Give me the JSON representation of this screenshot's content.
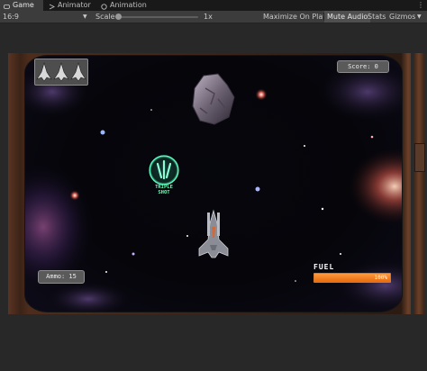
{
  "tabs": [
    {
      "label": "Game",
      "icon": "gamepad-icon",
      "active": true
    },
    {
      "label": "Animator",
      "icon": "animator-icon",
      "active": false
    },
    {
      "label": "Animation",
      "icon": "animation-icon",
      "active": false
    }
  ],
  "tab_menu": "⋮",
  "toolbar": {
    "aspect": "16:9",
    "scale_label": "Scale",
    "scale_value": "1x",
    "scale_level": 0.0,
    "maximize_on_play": "Maximize On Play",
    "mute_audio": "Mute Audio",
    "mute_audio_active": true,
    "stats": "Stats",
    "gizmos": "Gizmos"
  },
  "game": {
    "score_text": "Score: 0",
    "ammo_text": "Ammo: 15",
    "fuel_label": "FUEL",
    "fuel_percent_text": "100%",
    "fuel_level": 1.0,
    "powerup_label_line1": "TRIPLE",
    "powerup_label_line2": "SHOT",
    "lives_remaining": 3
  },
  "colors": {
    "accent_fuel": "#e76c10",
    "powerup_green": "#6cffb8",
    "editor_bg": "#282828"
  }
}
